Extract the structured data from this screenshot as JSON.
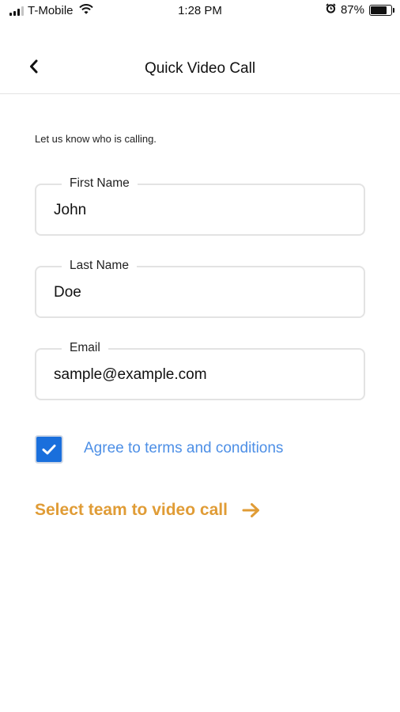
{
  "status_bar": {
    "carrier": "T-Mobile",
    "time": "1:28 PM",
    "battery": "87%"
  },
  "nav": {
    "title": "Quick Video Call"
  },
  "form": {
    "prompt": "Let us know who is calling.",
    "first_name": {
      "label": "First Name",
      "value": "John"
    },
    "last_name": {
      "label": "Last Name",
      "value": "Doe"
    },
    "email": {
      "label": "Email",
      "value": "sample@example.com"
    },
    "terms": {
      "label": "Agree to terms and conditions",
      "checked": true
    }
  },
  "cta": {
    "label": "Select team to video call"
  },
  "colors": {
    "accent_blue": "#1a6fdc",
    "link_blue": "#4d8fe6",
    "cta_orange": "#e09c36"
  }
}
